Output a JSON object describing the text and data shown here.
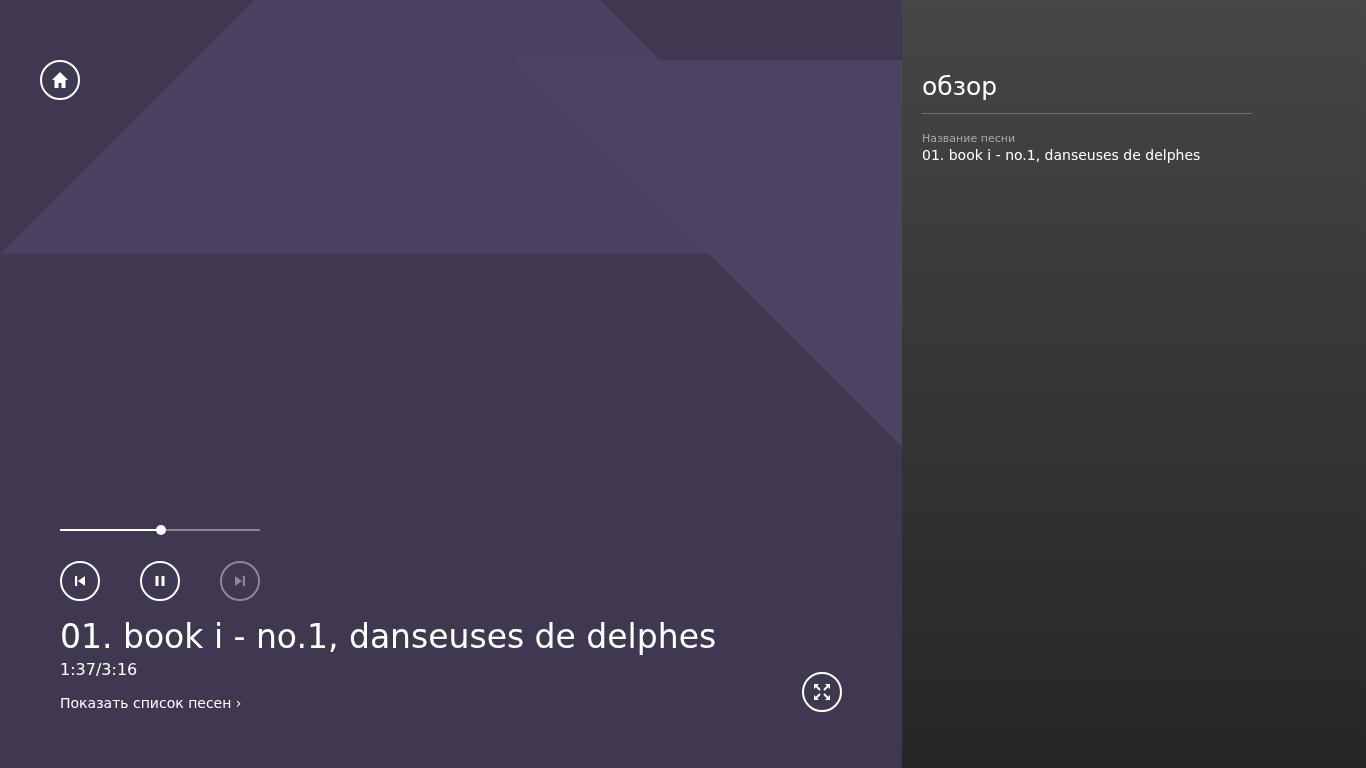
{
  "player": {
    "progress": {
      "level": 0.505
    },
    "controls": [
      {
        "kind": "previous",
        "disabled": false
      },
      {
        "kind": "pause",
        "disabled": false
      },
      {
        "kind": "next",
        "disabled": true
      }
    ],
    "track_title": "01. book i - no.1, danseuses de delphes",
    "time": "1:37/3:16",
    "song_list_link": "Показать список песен",
    "song_list_chevron": "›"
  },
  "panel": {
    "title": "обзор",
    "field_label": "Название песни",
    "field_value": "01. book i - no.1, danseuses de delphes"
  }
}
